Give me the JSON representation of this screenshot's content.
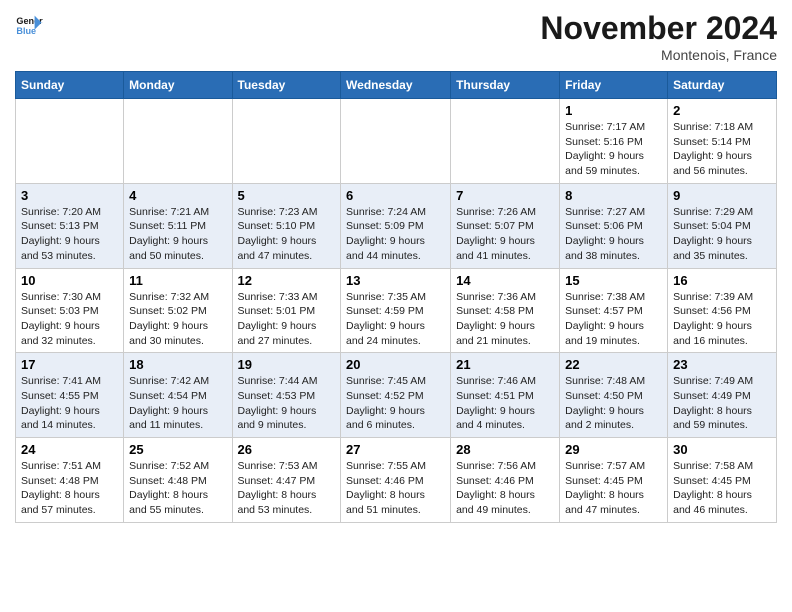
{
  "logo": {
    "text1": "General",
    "text2": "Blue"
  },
  "title": "November 2024",
  "location": "Montenois, France",
  "weekdays": [
    "Sunday",
    "Monday",
    "Tuesday",
    "Wednesday",
    "Thursday",
    "Friday",
    "Saturday"
  ],
  "weeks": [
    [
      {
        "day": "",
        "info": ""
      },
      {
        "day": "",
        "info": ""
      },
      {
        "day": "",
        "info": ""
      },
      {
        "day": "",
        "info": ""
      },
      {
        "day": "",
        "info": ""
      },
      {
        "day": "1",
        "info": "Sunrise: 7:17 AM\nSunset: 5:16 PM\nDaylight: 9 hours and 59 minutes."
      },
      {
        "day": "2",
        "info": "Sunrise: 7:18 AM\nSunset: 5:14 PM\nDaylight: 9 hours and 56 minutes."
      }
    ],
    [
      {
        "day": "3",
        "info": "Sunrise: 7:20 AM\nSunset: 5:13 PM\nDaylight: 9 hours and 53 minutes."
      },
      {
        "day": "4",
        "info": "Sunrise: 7:21 AM\nSunset: 5:11 PM\nDaylight: 9 hours and 50 minutes."
      },
      {
        "day": "5",
        "info": "Sunrise: 7:23 AM\nSunset: 5:10 PM\nDaylight: 9 hours and 47 minutes."
      },
      {
        "day": "6",
        "info": "Sunrise: 7:24 AM\nSunset: 5:09 PM\nDaylight: 9 hours and 44 minutes."
      },
      {
        "day": "7",
        "info": "Sunrise: 7:26 AM\nSunset: 5:07 PM\nDaylight: 9 hours and 41 minutes."
      },
      {
        "day": "8",
        "info": "Sunrise: 7:27 AM\nSunset: 5:06 PM\nDaylight: 9 hours and 38 minutes."
      },
      {
        "day": "9",
        "info": "Sunrise: 7:29 AM\nSunset: 5:04 PM\nDaylight: 9 hours and 35 minutes."
      }
    ],
    [
      {
        "day": "10",
        "info": "Sunrise: 7:30 AM\nSunset: 5:03 PM\nDaylight: 9 hours and 32 minutes."
      },
      {
        "day": "11",
        "info": "Sunrise: 7:32 AM\nSunset: 5:02 PM\nDaylight: 9 hours and 30 minutes."
      },
      {
        "day": "12",
        "info": "Sunrise: 7:33 AM\nSunset: 5:01 PM\nDaylight: 9 hours and 27 minutes."
      },
      {
        "day": "13",
        "info": "Sunrise: 7:35 AM\nSunset: 4:59 PM\nDaylight: 9 hours and 24 minutes."
      },
      {
        "day": "14",
        "info": "Sunrise: 7:36 AM\nSunset: 4:58 PM\nDaylight: 9 hours and 21 minutes."
      },
      {
        "day": "15",
        "info": "Sunrise: 7:38 AM\nSunset: 4:57 PM\nDaylight: 9 hours and 19 minutes."
      },
      {
        "day": "16",
        "info": "Sunrise: 7:39 AM\nSunset: 4:56 PM\nDaylight: 9 hours and 16 minutes."
      }
    ],
    [
      {
        "day": "17",
        "info": "Sunrise: 7:41 AM\nSunset: 4:55 PM\nDaylight: 9 hours and 14 minutes."
      },
      {
        "day": "18",
        "info": "Sunrise: 7:42 AM\nSunset: 4:54 PM\nDaylight: 9 hours and 11 minutes."
      },
      {
        "day": "19",
        "info": "Sunrise: 7:44 AM\nSunset: 4:53 PM\nDaylight: 9 hours and 9 minutes."
      },
      {
        "day": "20",
        "info": "Sunrise: 7:45 AM\nSunset: 4:52 PM\nDaylight: 9 hours and 6 minutes."
      },
      {
        "day": "21",
        "info": "Sunrise: 7:46 AM\nSunset: 4:51 PM\nDaylight: 9 hours and 4 minutes."
      },
      {
        "day": "22",
        "info": "Sunrise: 7:48 AM\nSunset: 4:50 PM\nDaylight: 9 hours and 2 minutes."
      },
      {
        "day": "23",
        "info": "Sunrise: 7:49 AM\nSunset: 4:49 PM\nDaylight: 8 hours and 59 minutes."
      }
    ],
    [
      {
        "day": "24",
        "info": "Sunrise: 7:51 AM\nSunset: 4:48 PM\nDaylight: 8 hours and 57 minutes."
      },
      {
        "day": "25",
        "info": "Sunrise: 7:52 AM\nSunset: 4:48 PM\nDaylight: 8 hours and 55 minutes."
      },
      {
        "day": "26",
        "info": "Sunrise: 7:53 AM\nSunset: 4:47 PM\nDaylight: 8 hours and 53 minutes."
      },
      {
        "day": "27",
        "info": "Sunrise: 7:55 AM\nSunset: 4:46 PM\nDaylight: 8 hours and 51 minutes."
      },
      {
        "day": "28",
        "info": "Sunrise: 7:56 AM\nSunset: 4:46 PM\nDaylight: 8 hours and 49 minutes."
      },
      {
        "day": "29",
        "info": "Sunrise: 7:57 AM\nSunset: 4:45 PM\nDaylight: 8 hours and 47 minutes."
      },
      {
        "day": "30",
        "info": "Sunrise: 7:58 AM\nSunset: 4:45 PM\nDaylight: 8 hours and 46 minutes."
      }
    ]
  ]
}
